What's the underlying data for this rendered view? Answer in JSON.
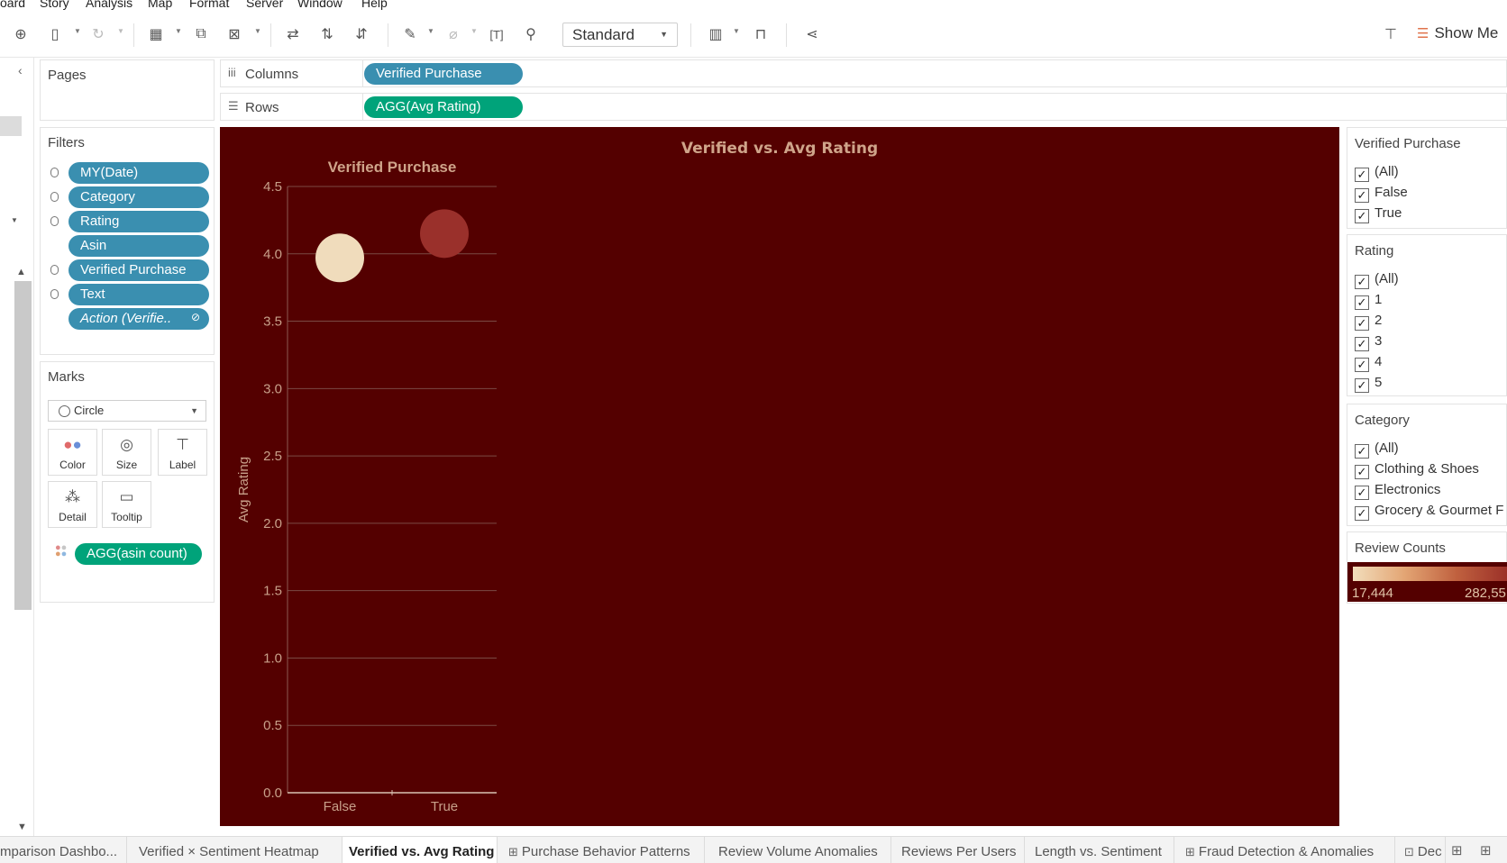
{
  "menu": [
    "oard",
    "Story",
    "Analysis",
    "Map",
    "Format",
    "Server",
    "Window",
    "Help"
  ],
  "toolbar": {
    "fit_select": "Standard",
    "show_me": "Show Me"
  },
  "shelves": {
    "pages_title": "Pages",
    "filters_title": "Filters",
    "filters": [
      "MY(Date)",
      "Category",
      "Rating",
      "Asin",
      "Verified Purchase",
      "Text",
      "Action (Verifie.."
    ],
    "marks_title": "Marks",
    "mark_type": "Circle",
    "mark_buttons": [
      "Color",
      "Size",
      "Label",
      "Detail",
      "Tooltip"
    ],
    "mark_pill": "AGG(asin count)",
    "columns_label": "Columns",
    "columns_pill": "Verified Purchase",
    "rows_label": "Rows",
    "rows_pill": "AGG(Avg Rating)"
  },
  "viz": {
    "title": "Verified vs. Avg Rating",
    "background": "#540000"
  },
  "chart_data": {
    "type": "scatter",
    "title": "Verified Purchase",
    "xlabel": "",
    "ylabel": "Avg Rating",
    "categories": [
      "False",
      "True"
    ],
    "values": [
      3.97,
      4.15
    ],
    "colors": [
      "#f0dcbc",
      "#9a302b"
    ],
    "ylim": [
      0,
      4.5
    ],
    "yticks": [
      "0.0",
      "0.5",
      "1.0",
      "1.5",
      "2.0",
      "2.5",
      "3.0",
      "3.5",
      "4.0",
      "4.5"
    ],
    "grid": true
  },
  "legends": {
    "verified": {
      "title": "Verified Purchase",
      "items": [
        "(All)",
        "False",
        "True"
      ]
    },
    "rating": {
      "title": "Rating",
      "items": [
        "(All)",
        "1",
        "2",
        "3",
        "4",
        "5"
      ]
    },
    "category": {
      "title": "Category",
      "items": [
        "(All)",
        "Clothing & Shoes",
        "Electronics",
        "Grocery & Gourmet F"
      ]
    },
    "review_counts": {
      "title": "Review Counts",
      "min": "17,444",
      "max": "282,55"
    }
  },
  "tabs": [
    {
      "label": "mparison Dashbo...",
      "icon": ""
    },
    {
      "label": "Verified × Sentiment Heatmap",
      "icon": ""
    },
    {
      "label": "Verified vs. Avg Rating",
      "icon": "",
      "active": true
    },
    {
      "label": "Purchase Behavior Patterns",
      "icon": "⊞"
    },
    {
      "label": "Review Volume Anomalies",
      "icon": ""
    },
    {
      "label": "Reviews Per Users",
      "icon": ""
    },
    {
      "label": "Length vs. Sentiment",
      "icon": ""
    },
    {
      "label": "Fraud Detection & Anomalies",
      "icon": "⊞"
    },
    {
      "label": "Dec",
      "icon": "⊡"
    }
  ]
}
